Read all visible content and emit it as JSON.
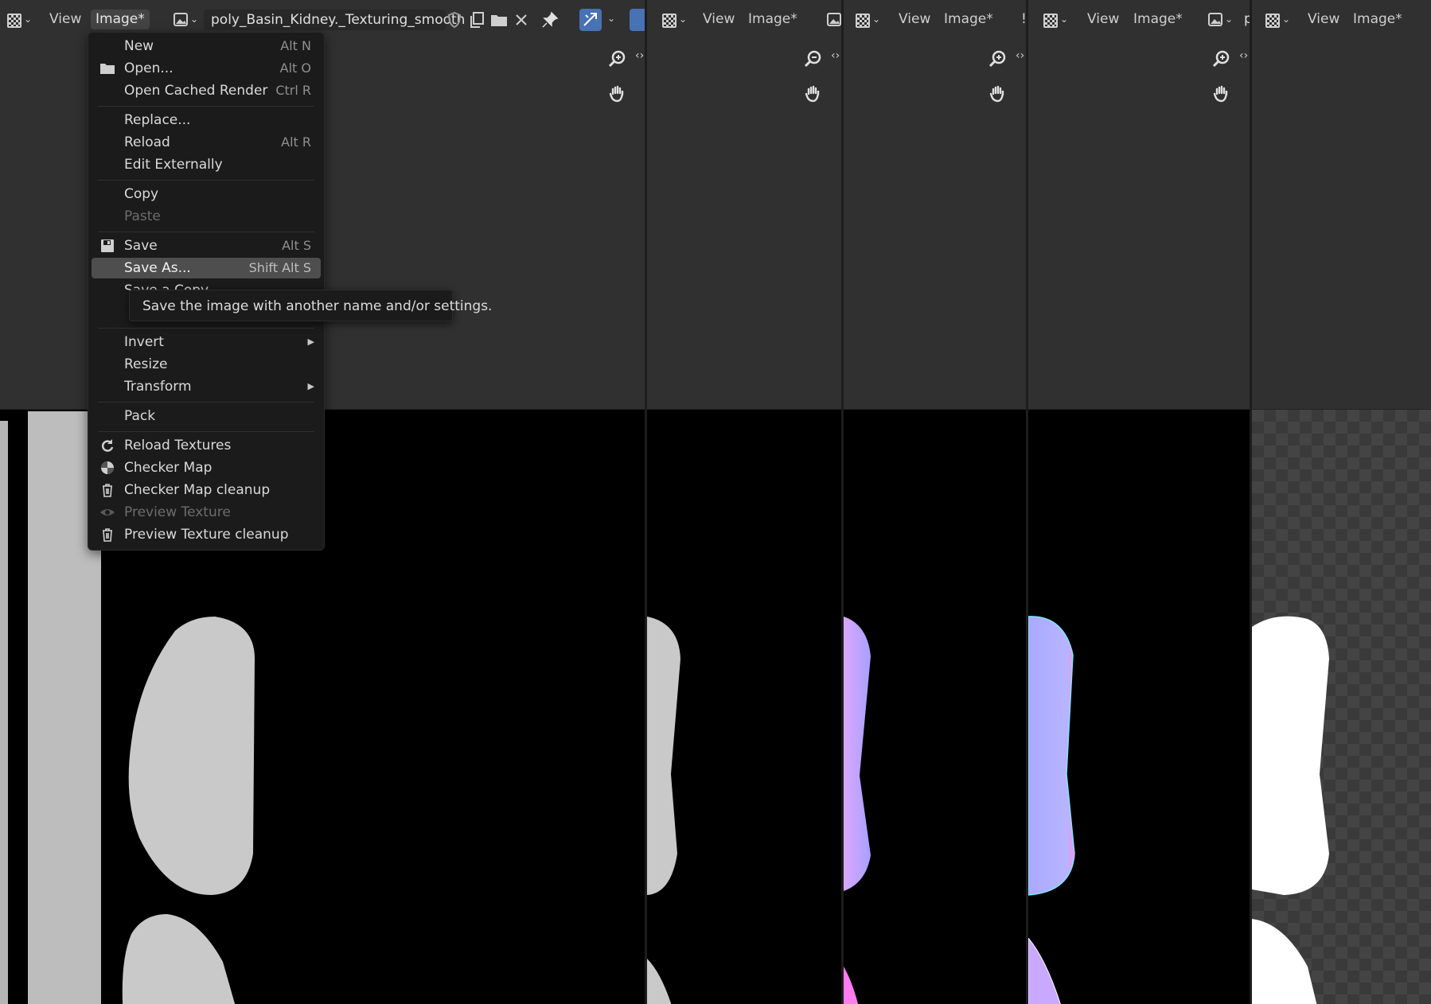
{
  "colors": {
    "background": "#303030",
    "menu_bg": "#1b1b1b",
    "highlight": "#4e4e4e",
    "accent_blue": "#4772b3",
    "canvas_black": "#000000",
    "gray_mask": "#c9c9c9",
    "normal_map": "#b9b0ff",
    "white_mask": "#ffffff"
  },
  "panes": [
    {
      "view_label": "View",
      "image_label": "Image*",
      "image_name": "poly_Basin_Kidney._Texturing_smooth"
    },
    {
      "view_label": "View",
      "image_label": "Image*"
    },
    {
      "view_label": "View",
      "image_label": "Image*"
    },
    {
      "view_label": "View",
      "image_label": "Image*"
    },
    {
      "view_label": "View",
      "image_label": "Image*"
    }
  ],
  "pane4_cut_name": "p",
  "menu": {
    "items": [
      {
        "label": "New",
        "shortcut": "Alt N",
        "icon": ""
      },
      {
        "label": "Open...",
        "shortcut": "Alt O",
        "icon": "folder-icon"
      },
      {
        "label": "Open Cached Render",
        "shortcut": "Ctrl R",
        "icon": ""
      },
      {
        "label": "Replace...",
        "shortcut": "",
        "icon": ""
      },
      {
        "label": "Reload",
        "shortcut": "Alt R",
        "icon": ""
      },
      {
        "label": "Edit Externally",
        "shortcut": "",
        "icon": ""
      },
      {
        "label": "Copy",
        "shortcut": "",
        "icon": ""
      },
      {
        "label": "Paste",
        "shortcut": "",
        "icon": "",
        "disabled": true
      },
      {
        "label": "Save",
        "shortcut": "Alt S",
        "icon": "save-icon"
      },
      {
        "label": "Save As...",
        "shortcut": "Shift Alt S",
        "icon": "",
        "highlighted": true
      },
      {
        "label": "Save a Copy",
        "shortcut": "",
        "icon": ""
      },
      {
        "label": "S",
        "shortcut": "",
        "icon": ""
      },
      {
        "label": "Invert",
        "shortcut": "",
        "icon": "",
        "submenu": true
      },
      {
        "label": "Resize",
        "shortcut": "",
        "icon": ""
      },
      {
        "label": "Transform",
        "shortcut": "",
        "icon": "",
        "submenu": true
      },
      {
        "label": "Pack",
        "shortcut": "",
        "icon": ""
      },
      {
        "label": "Reload Textures",
        "shortcut": "",
        "icon": "reload-icon"
      },
      {
        "label": "Checker Map",
        "shortcut": "",
        "icon": "checker-ball-icon"
      },
      {
        "label": "Checker Map cleanup",
        "shortcut": "",
        "icon": "trash-icon"
      },
      {
        "label": "Preview Texture",
        "shortcut": "",
        "icon": "eye-icon",
        "disabled": true
      },
      {
        "label": "Preview Texture cleanup",
        "shortcut": "",
        "icon": "trash-icon"
      }
    ]
  },
  "tooltip": "Save the image with another name and/or settings."
}
